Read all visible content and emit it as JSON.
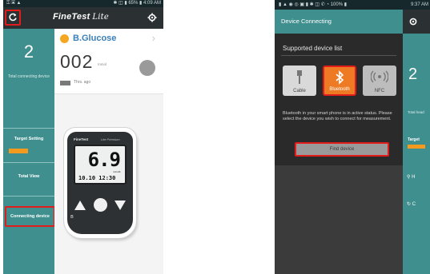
{
  "left": {
    "status": {
      "left": "⚿ ▣ ▲",
      "right": "✱ ◫ ▮ 65% ▮ 4:09 AM"
    },
    "header": {
      "brand": "FineTest",
      "brand_suffix": "Lite"
    },
    "nav": {
      "count": "2",
      "count_label": "Total connecting device",
      "target_label": "Target Setting",
      "target_badge": "",
      "total_view_label": "Total View",
      "connecting_label": "Connecting device"
    },
    "glucose": {
      "label": "B.Glucose",
      "value": "002",
      "unit": "mmol",
      "circle_label": "",
      "time_ago": "Thrs. ago"
    },
    "meter": {
      "brand": "FineTest",
      "brand_suffix": "Lite Premium",
      "reading": "6.9",
      "unit": "mmol/L",
      "datetime": "10.10 12:30"
    }
  },
  "right": {
    "status": {
      "left": "▮ ▲ ◉ ◎ ▣  ▮ ✱ ◫ ✆ ◔ 100% ▮",
      "time": "9:37 AM"
    },
    "header": {
      "title": "Device Connecting"
    },
    "dialog": {
      "heading": "Supported device list",
      "devices": [
        {
          "label": "Cable",
          "icon": "usb-icon",
          "active": false
        },
        {
          "label": "Bluetooth",
          "icon": "bluetooth-icon",
          "active": true
        },
        {
          "label": "NFC",
          "icon": "nfc-icon",
          "active": false
        }
      ],
      "info": "Bluetooth in your smart phone is in active status. Please select the device you wish to connect for measurement.",
      "find_button": "Find device"
    },
    "strip": {
      "num": "2",
      "text": "Total \n head",
      "target": "Target",
      "row1": "H",
      "row2": "C"
    }
  },
  "colors": {
    "teal": "#3f8f8e",
    "dark": "#2b3033",
    "orange": "#ee7b24",
    "highlight": "#e21b1b",
    "glucose_label": "#3a7fb8"
  }
}
